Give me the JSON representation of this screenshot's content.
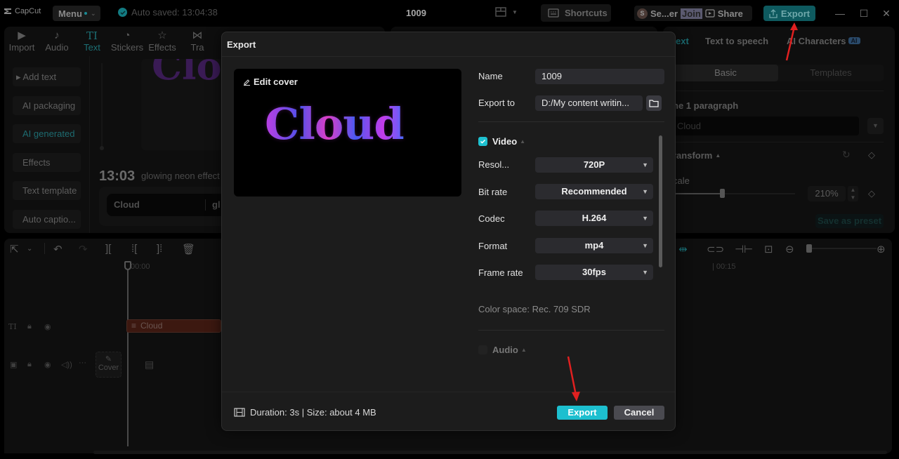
{
  "app": {
    "logo_text": "CapCut",
    "menu_label": "Menu",
    "autosave_text": "Auto saved: 13:04:38",
    "project_title": "1009",
    "shortcuts_label": "Shortcuts",
    "collab_user_initial": "S",
    "collab_user_name": "Se...er",
    "join_label": "Join",
    "share_label": "Share",
    "export_label": "Export",
    "window_controls": {
      "minimize": "—",
      "maximize": "☐",
      "close": "✕"
    }
  },
  "media_tabs": [
    {
      "label": "Import",
      "icon": "import-icon",
      "glyph": "▶"
    },
    {
      "label": "Audio",
      "icon": "audio-icon",
      "glyph": "♪"
    },
    {
      "label": "Text",
      "icon": "text-icon",
      "glyph": "TI",
      "active": true
    },
    {
      "label": "Stickers",
      "icon": "sticker-icon",
      "glyph": "◔"
    },
    {
      "label": "Effects",
      "icon": "effects-icon",
      "glyph": "☆"
    },
    {
      "label": "Tra",
      "icon": "transitions-icon",
      "glyph": "⋈"
    }
  ],
  "text_sidebar": [
    {
      "label": "▸ Add text"
    },
    {
      "label": "AI packaging"
    },
    {
      "label": "AI generated",
      "active": true
    },
    {
      "label": "Effects"
    },
    {
      "label": "Text template"
    },
    {
      "label": "Auto captio..."
    }
  ],
  "ai_generated": {
    "preview_word": "Clo",
    "time": "13:03",
    "description": "glowing neon effect",
    "input_value": "Cloud",
    "input_suffix": "gl"
  },
  "right_panel": {
    "tabs": [
      {
        "label": "ext",
        "active": true
      },
      {
        "label": "Text to speech"
      },
      {
        "label": "AI Characters",
        "badge": "AI"
      }
    ],
    "segments": [
      {
        "label": "Basic",
        "active": true
      },
      {
        "label": "Templates"
      }
    ],
    "paragraph_label": "he 1 paragraph",
    "paragraph_value": "Cloud",
    "transform_label": "ransform",
    "scale_label": "cale",
    "scale_value": "210%",
    "save_preset_label": "Save as preset"
  },
  "timeline": {
    "timecode_start": "00:00",
    "timecode_15": "| 00:15",
    "text_clip_label": "Cloud",
    "cover_label": "Cover"
  },
  "export_dialog": {
    "title": "Export",
    "edit_cover_label": "Edit cover",
    "cover_text": "Cloud",
    "name_label": "Name",
    "name_value": "1009",
    "export_to_label": "Export to",
    "export_to_value": "D:/My content writin...",
    "video_section_label": "Video",
    "video_enabled": true,
    "settings": [
      {
        "label": "Resol...",
        "value": "720P"
      },
      {
        "label": "Bit rate",
        "value": "Recommended"
      },
      {
        "label": "Codec",
        "value": "H.264"
      },
      {
        "label": "Format",
        "value": "mp4"
      },
      {
        "label": "Frame rate",
        "value": "30fps"
      }
    ],
    "color_space": "Color space: Rec. 709 SDR",
    "audio_section_label": "Audio",
    "audio_enabled": false,
    "duration_size": "Duration: 3s | Size: about 4 MB",
    "export_button": "Export",
    "cancel_button": "Cancel"
  },
  "colors": {
    "accent": "#1dbfcf",
    "annotation_arrow": "#e02020"
  }
}
